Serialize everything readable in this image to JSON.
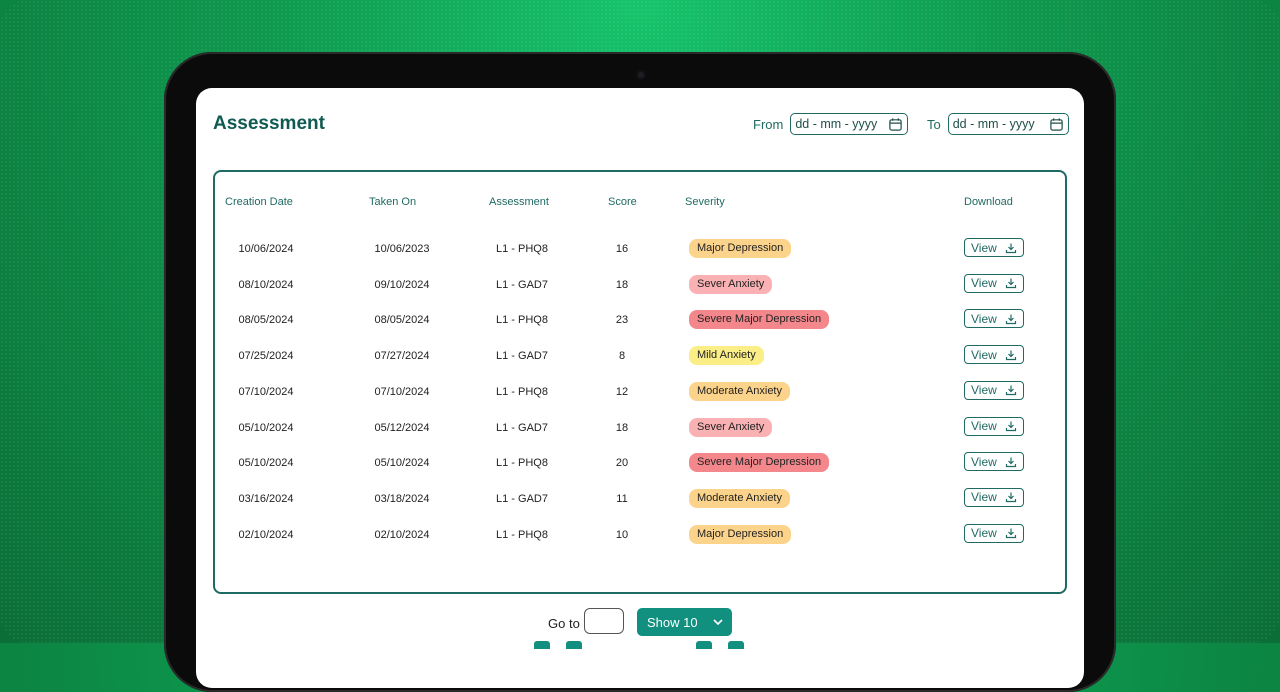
{
  "page": {
    "title": "Assessment"
  },
  "filters": {
    "from_label": "From",
    "to_label": "To",
    "from_placeholder": "dd - mm - yyyy",
    "to_placeholder": "dd - mm - yyyy"
  },
  "table": {
    "headers": [
      "Creation Date",
      "Taken On",
      "Assessment",
      "Score",
      "Severity",
      "Download"
    ],
    "view_label": "View",
    "rows": [
      {
        "created": "10/06/2024",
        "taken": "10/06/2023",
        "assessment": "L1 - PHQ8",
        "score": "16",
        "severity": "Major Depression",
        "color": "#fcd38a"
      },
      {
        "created": "08/10/2024",
        "taken": "09/10/2024",
        "assessment": "L1 - GAD7",
        "score": "18",
        "severity": "Sever Anxiety",
        "color": "#f9b1b3"
      },
      {
        "created": "08/05/2024",
        "taken": "08/05/2024",
        "assessment": "L1 - PHQ8",
        "score": "23",
        "severity": "Severe Major Depression",
        "color": "#f3878c"
      },
      {
        "created": "07/25/2024",
        "taken": "07/27/2024",
        "assessment": "L1 - GAD7",
        "score": "8",
        "severity": "Mild Anxiety",
        "color": "#fbee86"
      },
      {
        "created": "07/10/2024",
        "taken": "07/10/2024",
        "assessment": "L1 - PHQ8",
        "score": "12",
        "severity": "Moderate Anxiety",
        "color": "#fcd38a"
      },
      {
        "created": "05/10/2024",
        "taken": "05/12/2024",
        "assessment": "L1 - GAD7",
        "score": "18",
        "severity": "Sever Anxiety",
        "color": "#f9b1b3"
      },
      {
        "created": "05/10/2024",
        "taken": "05/10/2024",
        "assessment": "L1 - PHQ8",
        "score": "20",
        "severity": "Severe Major Depression",
        "color": "#f3878c"
      },
      {
        "created": "03/16/2024",
        "taken": "03/18/2024",
        "assessment": "L1 - GAD7",
        "score": "11",
        "severity": "Moderate Anxiety",
        "color": "#fcd38a"
      },
      {
        "created": "02/10/2024",
        "taken": "02/10/2024",
        "assessment": "L1 - PHQ8",
        "score": "10",
        "severity": "Major Depression",
        "color": "#fcd38a"
      }
    ]
  },
  "pagination": {
    "goto_label": "Go to",
    "show_label": "Show 10"
  },
  "icons": {
    "calendar": "calendar-icon",
    "download": "download-icon",
    "chevron": "chevron-down-icon"
  }
}
